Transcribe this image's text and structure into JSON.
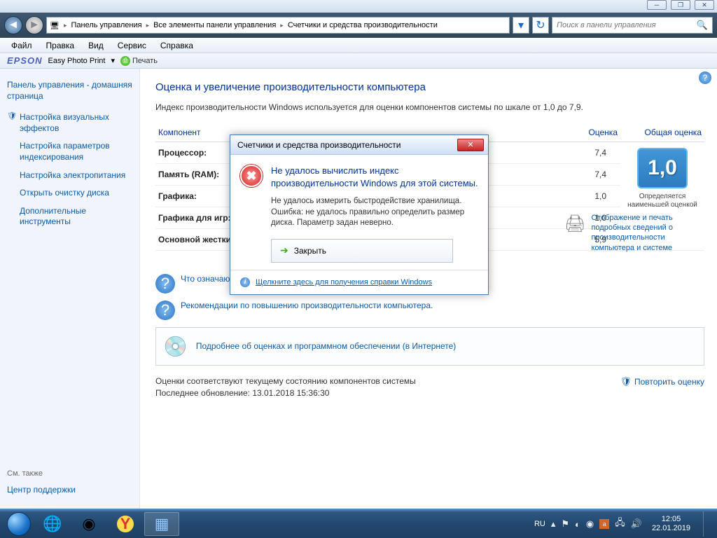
{
  "titlebar": {
    "min": "─",
    "max": "❐",
    "close": "✕"
  },
  "nav": {
    "crumbs": [
      "Панель управления",
      "Все элементы панели управления",
      "Счетчики и средства производительности"
    ],
    "search_placeholder": "Поиск в панели управления"
  },
  "menu": {
    "file": "Файл",
    "edit": "Правка",
    "view": "Вид",
    "service": "Сервис",
    "help": "Справка"
  },
  "epson": {
    "logo": "EPSON",
    "app": "Easy Photo Print",
    "print": "Печать"
  },
  "sidebar": {
    "home": "Панель управления - домашняя страница",
    "links": [
      "Настройка визуальных эффектов",
      "Настройка параметров индексирования",
      "Настройка электропитания",
      "Открыть очистку диска",
      "Дополнительные инструменты"
    ],
    "also_h": "См. также",
    "also_link": "Центр поддержки"
  },
  "main": {
    "title": "Оценка и увеличение производительности компьютера",
    "intro": "Индекс производительности Windows используется для оценки компонентов системы по шкале от 1,0 до 7,9.",
    "col_component": "Компонент",
    "col_score": "Оценка",
    "col_overall": "Общая оценка",
    "rows": [
      {
        "name": "Процессор:",
        "score": "7,4"
      },
      {
        "name": "Память (RAM):",
        "score": "7,4"
      },
      {
        "name": "Графика:",
        "score": "1,0"
      },
      {
        "name": "Графика для игр:",
        "score": "1,0"
      },
      {
        "name": "Основной жесткий диск:",
        "score": "5,9"
      }
    ],
    "big_score": "1,0",
    "big_label": "Определяется наименьшей оценкой",
    "q1": "Что означают эти цифры?",
    "q2": "Рекомендации по повышению производительности компьютера.",
    "print_link": "Отображение и печать подробных сведений о производительности компьютера и системе",
    "more": "Подробнее об оценках и программном обеспечении (в Интернете)",
    "status": "Оценки соответствуют текущему состоянию компонентов системы",
    "updated": "Последнее обновление: 13.01.2018 15:36:30",
    "rerun": "Повторить оценку"
  },
  "modal": {
    "title": "Счетчики и средства производительности",
    "heading": "Не удалось вычислить индекс производительности Windows для этой системы.",
    "detail": "Не удалось измерить быстродействие хранилища. Ошибка: не удалось правильно определить размер диска. Параметр задан неверно.",
    "button": "Закрыть",
    "help": "Щелкните здесь для получения справки Windows"
  },
  "taskbar": {
    "lang": "RU",
    "time": "12:05",
    "date": "22.01.2019"
  }
}
